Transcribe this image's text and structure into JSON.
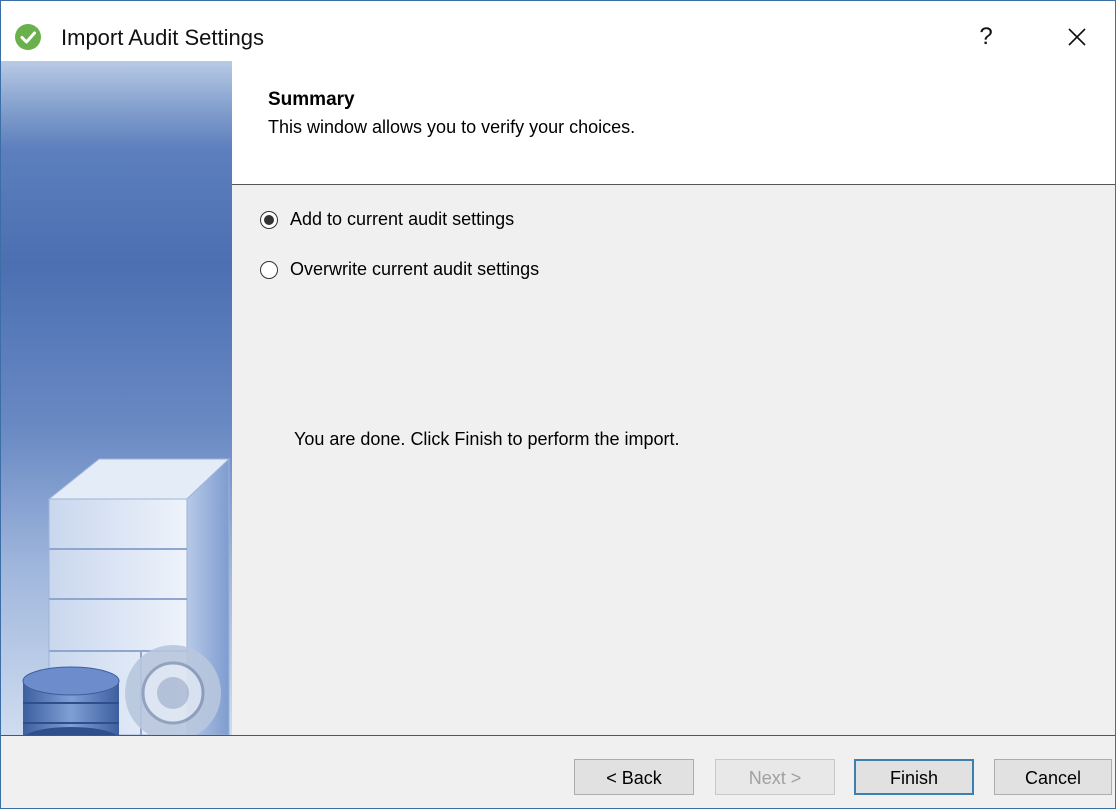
{
  "window": {
    "title": "Import Audit Settings",
    "help_label": "?",
    "app_icon": "green-check-circle-icon",
    "close_icon": "close-icon"
  },
  "header": {
    "title": "Summary",
    "subtitle": "This window allows you to verify your choices."
  },
  "options": {
    "add": {
      "label": "Add to current audit settings",
      "checked": true
    },
    "overwrite": {
      "label": "Overwrite current audit settings",
      "checked": false
    }
  },
  "message": "You are done.  Click Finish to perform the import.",
  "buttons": {
    "back": "< Back",
    "next": "Next >",
    "finish": "Finish",
    "cancel": "Cancel"
  },
  "colors": {
    "accent": "#3c7fb1",
    "check": "#6ab04c",
    "side_panel": "#4b6fb1"
  }
}
